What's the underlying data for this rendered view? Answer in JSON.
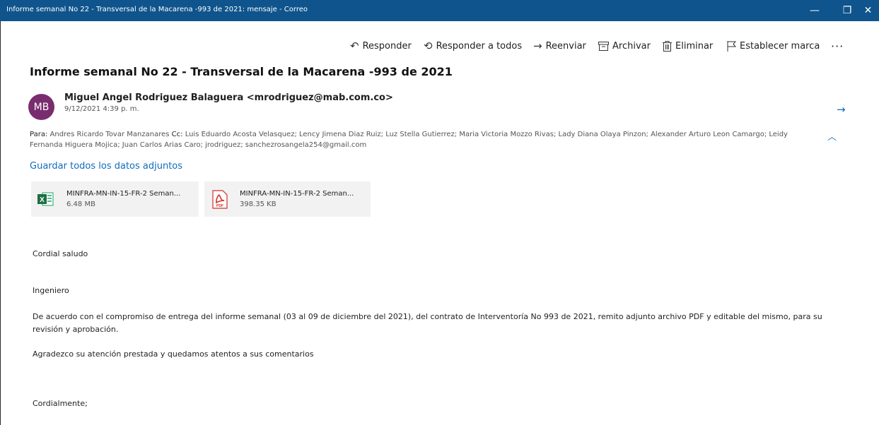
{
  "window": {
    "title": "Informe semanal No 22 - Transversal de la Macarena -993 de 2021: mensaje - Correo",
    "minimize_glyph": "—",
    "maximize_glyph": "❐",
    "close_glyph": "✕"
  },
  "toolbar": {
    "reply_label": "Responder",
    "reply_all_label": "Responder a todos",
    "forward_label": "Reenviar",
    "archive_label": "Archivar",
    "delete_label": "Eliminar",
    "flag_label": "Establecer marca",
    "more_label": "···"
  },
  "message": {
    "subject": "Informe semanal No 22 - Transversal de la Macarena -993 de 2021",
    "avatar_initials": "MB",
    "avatar_color": "#7a2d6e",
    "sender": "Miguel Angel Rodriguez Balaguera <mrodriguez@mab.com.co>",
    "date": "9/12/2021 4:39 p. m.",
    "to_label": "Para:",
    "to_value": "Andres Ricardo Tovar Manzanares",
    "cc_label": "Cc:",
    "cc_value": "Luis Eduardo Acosta Velasquez; Lency Jimena Diaz Ruiz; Luz Stella Gutierrez; Maria Victoria Mozzo Rivas; Lady Diana Olaya Pinzon; Alexander Arturo Leon Camargo; Leidy Fernanda Higuera Mojica; Juan Carlos Arias Caro; jrodriguez; sanchezrosangela254@gmail.com",
    "save_all_label": "Guardar todos los datos adjuntos",
    "attachments": [
      {
        "name": "MINFRA-MN-IN-15-FR-2 Seman...",
        "size": "6.48 MB",
        "icon": "excel-icon"
      },
      {
        "name": "MINFRA-MN-IN-15-FR-2 Seman...",
        "size": "398.35 KB",
        "icon": "pdf-icon"
      }
    ],
    "body": [
      "Cordial saludo",
      "Ingeniero",
      "De acuerdo con el compromiso de entrega del informe semanal (03 al 09 de diciembre del 2021), del contrato de Interventoría No 993 de 2021, remito adjunto archivo PDF y editable del mismo, para su revisión y aprobación.",
      "Agradezco su atención prestada y quedamos atentos a sus comentarios",
      "Cordialmente;"
    ]
  },
  "colors": {
    "titlebar": "#0f548c",
    "link": "#0f6cbd",
    "excel_green": "#1d6f42",
    "pdf_red": "#d0312d"
  }
}
